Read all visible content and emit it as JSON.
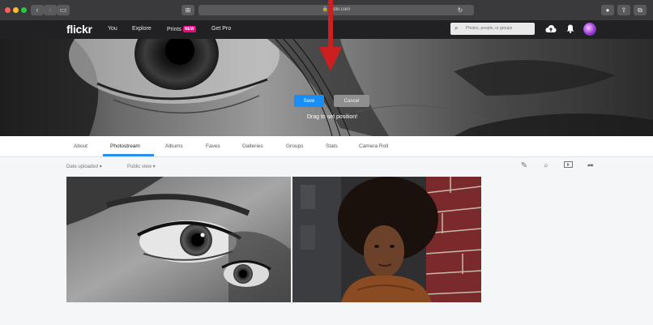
{
  "browser": {
    "url": "flickr.com",
    "icons": [
      "back-icon",
      "forward-icon",
      "sidebar-icon",
      "grid-icon",
      "reload-icon",
      "profile-icon",
      "share-icon",
      "tabs-icon"
    ]
  },
  "nav": {
    "logo": "flickr",
    "links": [
      "You",
      "Explore",
      "Prints",
      "Get Pro"
    ],
    "new_badge": "NEW",
    "search_placeholder": "Photos, people, or groups"
  },
  "cover": {
    "save_label": "Save",
    "cancel_label": "Cancel",
    "hint": "Drag to set position!"
  },
  "tabs": [
    "About",
    "Photostream",
    "Albums",
    "Faves",
    "Galleries",
    "Groups",
    "Stats",
    "Camera Roll"
  ],
  "active_tab": "Photostream",
  "filters": {
    "sort": "Date uploaded ▾",
    "view": "Public view ▾"
  },
  "colors": {
    "accent": "#1a8ef7",
    "brand_pink": "#ff0084",
    "annotation_arrow": "#cc1f1f"
  }
}
